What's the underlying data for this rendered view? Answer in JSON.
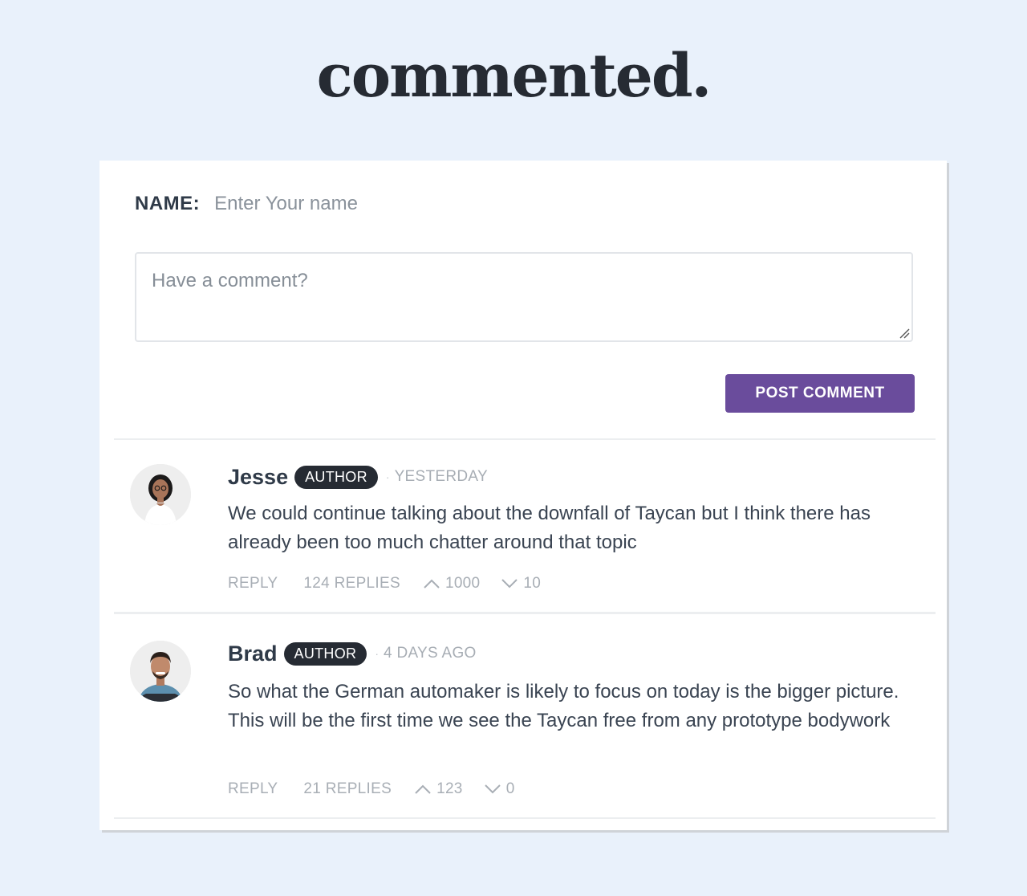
{
  "header": {
    "site_title": "commented."
  },
  "form": {
    "name_label": "NAME:",
    "name_placeholder": "Enter Your name",
    "comment_placeholder": "Have a comment?",
    "submit_label": "POST COMMENT"
  },
  "colors": {
    "page_background": "#e9f1fb",
    "accent": "#6a4c9c",
    "badge": "#262b33"
  },
  "comments": [
    {
      "author": "Jesse",
      "badge": "AUTHOR",
      "dot": "·",
      "time": "YESTERDAY",
      "text": "We could continue talking about the downfall of Taycan but I think there has already been too much chatter around that topic",
      "reply_label": "REPLY",
      "replies": "124 REPLIES",
      "upvotes": "1000",
      "downvotes": "10",
      "avatar": "woman-avatar"
    },
    {
      "author": "Brad",
      "badge": "AUTHOR",
      "dot": "·",
      "time": "4 DAYS AGO",
      "text": "So what the German automaker is likely to focus on today is the bigger picture. This will be the first time we see the Taycan free from any prototype bodywork",
      "reply_label": "REPLY",
      "replies": "21 REPLIES",
      "upvotes": "123",
      "downvotes": "0",
      "avatar": "man-avatar"
    }
  ]
}
